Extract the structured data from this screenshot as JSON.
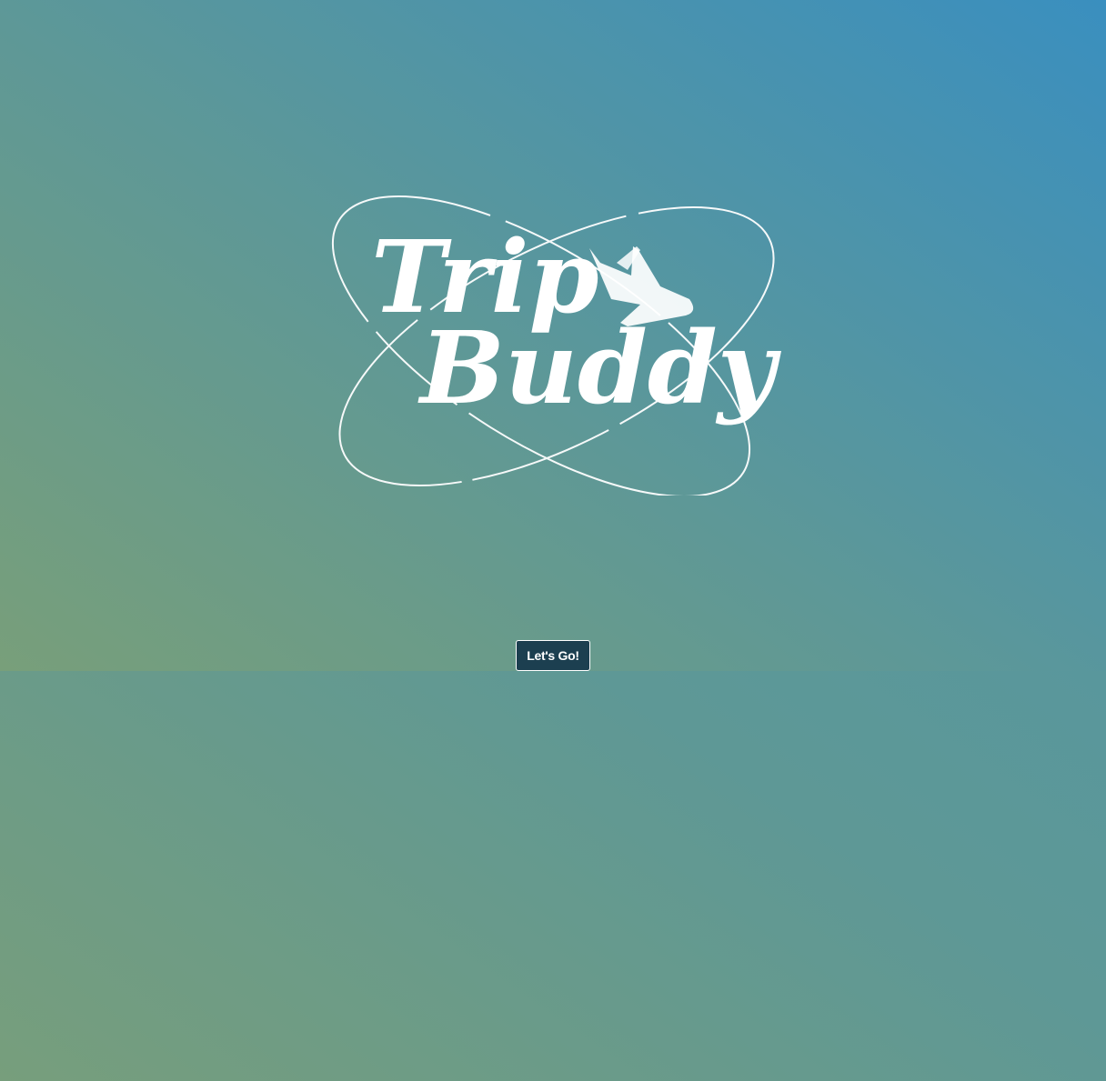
{
  "logo": {
    "line1": "Trip",
    "line2": "Buddy"
  },
  "cta": {
    "label": "Let's Go!"
  },
  "icons": {
    "logo_mark": "airplane-icon"
  },
  "colors": {
    "button_bg": "#1c3f50",
    "hero_gradient_start": "#789f7a",
    "hero_gradient_end": "#3a8fbf"
  }
}
